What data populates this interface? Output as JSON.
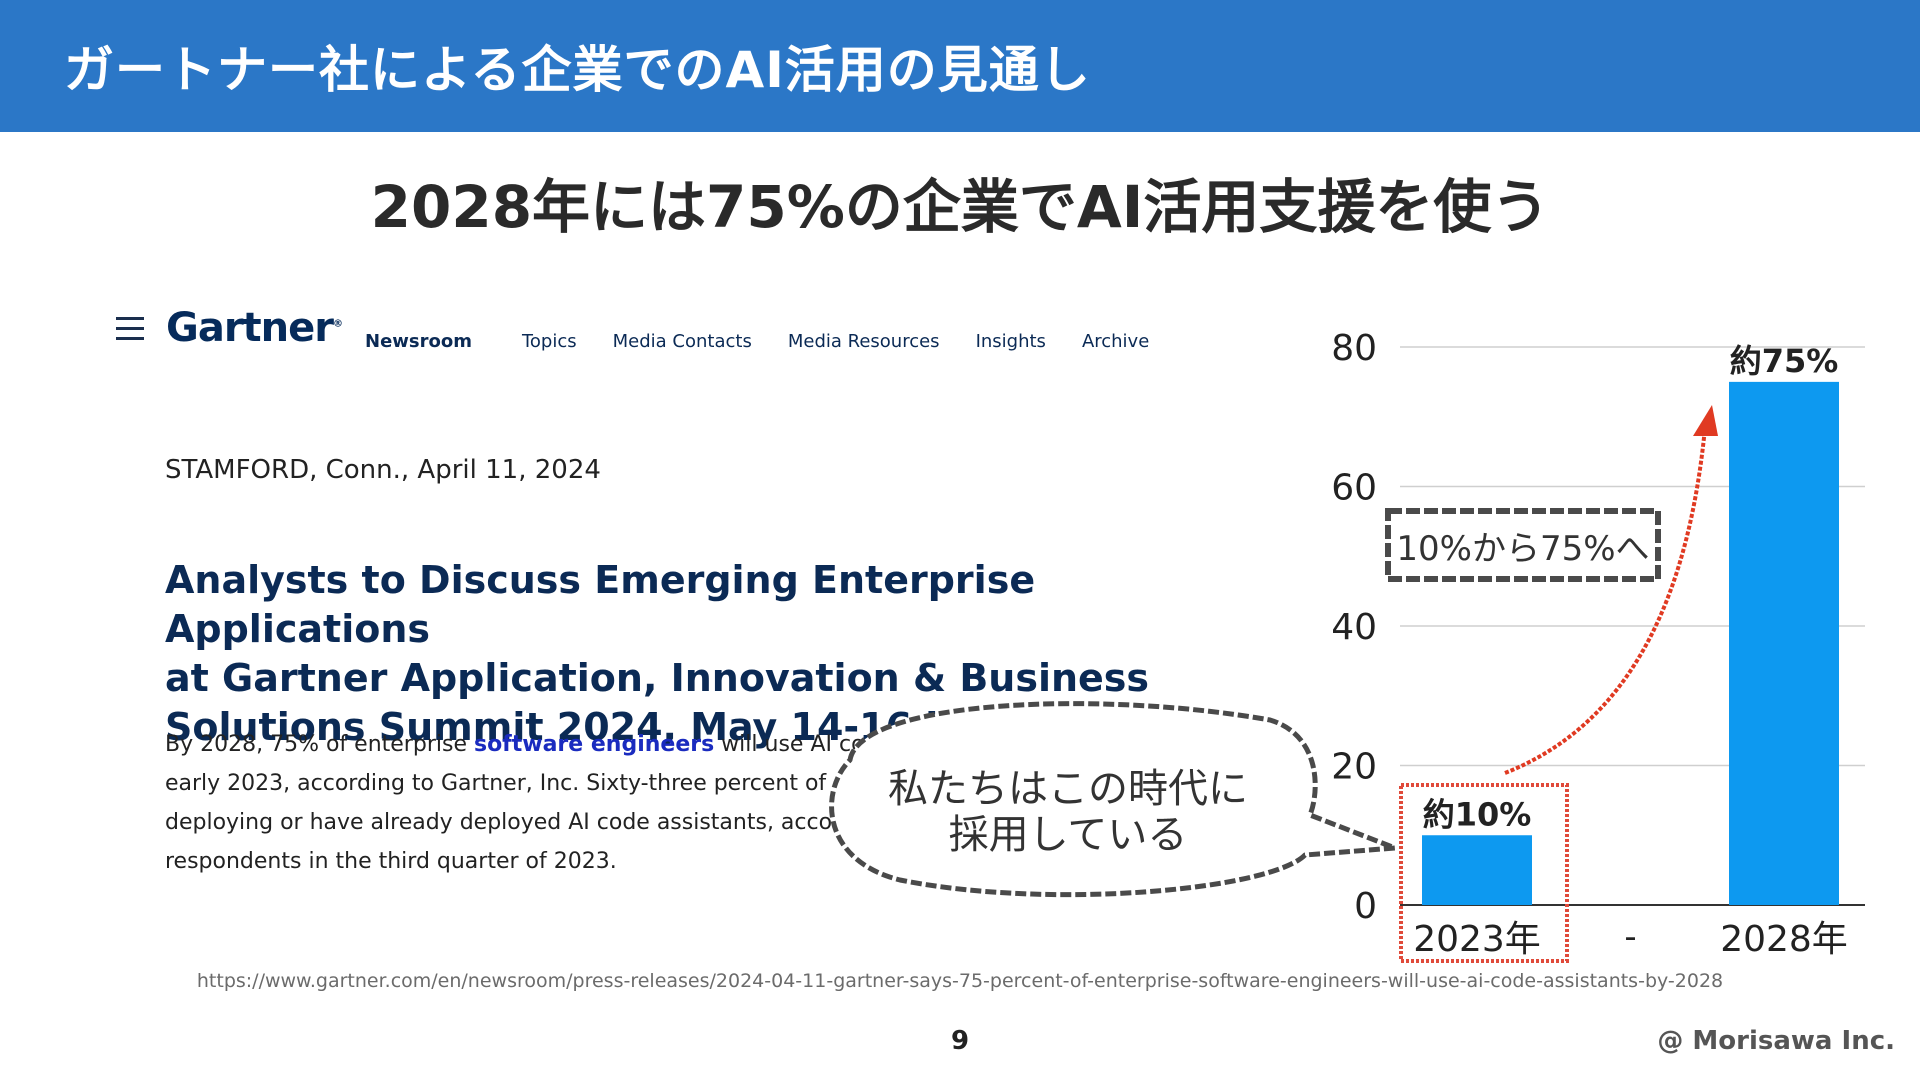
{
  "header": {
    "title": "ガートナー社による企業でのAI活用の見通し"
  },
  "subtitle": "2028年には75%の企業でAI活用支援を使う",
  "gartner": {
    "logo": "Gartner",
    "logo_mark": "®",
    "nav": [
      "Newsroom",
      "Topics",
      "Media Contacts",
      "Media Resources",
      "Insights",
      "Archive"
    ],
    "dateline": "STAMFORD, Conn., April 11, 2024",
    "headline": [
      "Analysts to Discuss Emerging Enterprise Applications",
      "at Gartner Application, Innovation & Business",
      "Solutions Summit 2024, May 14-16 in Las Vegas"
    ],
    "body": {
      "line1_pre": "By 2028, 75% of enterprise ",
      "line1_link": "software engineers",
      "line1_post": " will use AI code assi",
      "line2": "early 2023, according to Gartner, Inc. Sixty-three percent of o",
      "line3": "deploying or have already deployed AI code assistants, accor",
      "line4": "respondents in the third quarter of 2023."
    }
  },
  "callouts": {
    "speech": [
      "私たちはこの時代に",
      "採用している"
    ],
    "range_label": "10%から75%へ"
  },
  "chart_data": {
    "type": "bar",
    "categories": [
      "2023年",
      "2028年"
    ],
    "separator": "-",
    "values": [
      10,
      75
    ],
    "data_labels": [
      "約10%",
      "約75%"
    ],
    "yticks": [
      "0",
      "20",
      "40",
      "60",
      "80"
    ],
    "ylim": [
      0,
      80
    ],
    "grid": true,
    "colors": {
      "bar": "#0d99f0",
      "highlight": "#e04a3a",
      "arrow": "#e03a22"
    }
  },
  "source_url": "https://www.gartner.com/en/newsroom/press-releases/2024-04-11-gartner-says-75-percent-of-enterprise-software-engineers-will-use-ai-code-assistants-by-2028",
  "footer": {
    "page_number": "9",
    "copyright": "@ Morisawa Inc."
  }
}
